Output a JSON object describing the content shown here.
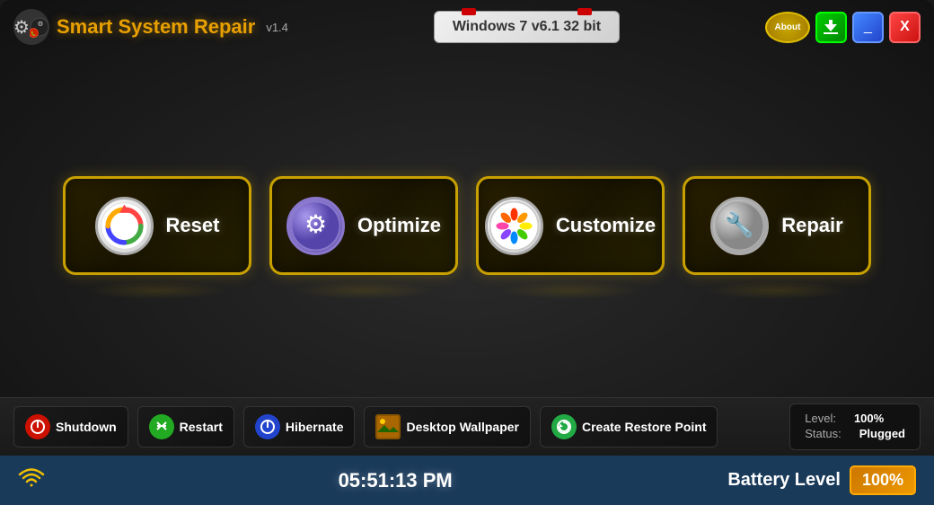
{
  "header": {
    "title": "Smart System Repair",
    "version": "v1.4",
    "os_info": "Windows 7 v6.1 32 bit",
    "about_label": "About",
    "minimize_label": "_",
    "close_label": "X"
  },
  "main_buttons": [
    {
      "id": "reset",
      "label": "Reset",
      "icon_type": "reset"
    },
    {
      "id": "optimize",
      "label": "Optimize",
      "icon_type": "optimize"
    },
    {
      "id": "customize",
      "label": "Customize",
      "icon_type": "customize"
    },
    {
      "id": "repair",
      "label": "Repair",
      "icon_type": "repair"
    }
  ],
  "bottom_actions": [
    {
      "id": "shutdown",
      "label": "Shutdown",
      "icon_color": "shutdown"
    },
    {
      "id": "restart",
      "label": "Restart",
      "icon_color": "restart"
    },
    {
      "id": "hibernate",
      "label": "Hibernate",
      "icon_color": "hibernate"
    },
    {
      "id": "wallpaper",
      "label": "Desktop Wallpaper",
      "icon_color": "wallpaper"
    },
    {
      "id": "restore",
      "label": "Create Restore Point",
      "icon_color": "restore"
    }
  ],
  "battery_panel": {
    "level_label": "Level:",
    "level_value": "100%",
    "status_label": "Status:",
    "status_value": "Plugged"
  },
  "status_bar": {
    "clock": "05:51:13 PM",
    "battery_label": "Battery Level",
    "battery_pct": "100%"
  }
}
